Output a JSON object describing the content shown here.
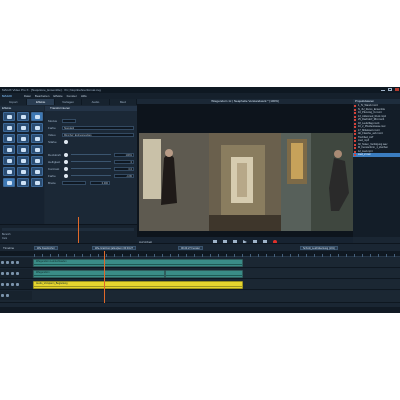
{
  "titlebar": {
    "title": "MAGIX Video Pro X · [Nuquitone_Ensemble] · X1 | Nopnbehnerformat.svg"
  },
  "menubar": {
    "logo": "MAGIX",
    "items": [
      "Datei",
      "Bearbeiten",
      "Effekte",
      "Fenster",
      "Hilfe"
    ]
  },
  "left_tabs": [
    "Import",
    "Effekte",
    "Vorlagen",
    "Audio",
    "Med"
  ],
  "effects_panel": {
    "header": "Effekte"
  },
  "properties": {
    "header": [
      "Transformieren"
    ],
    "rows": [
      {
        "label": "Modus",
        "value": ""
      },
      {
        "label": "Farbe",
        "value": "Standard"
      },
      {
        "label": "Video",
        "value": "Minichef_Endrespexdiag"
      },
      {
        "label": "Stärke",
        "value": ""
      }
    ],
    "sliders": [
      {
        "label": "Deckkraft",
        "value": "100%"
      },
      {
        "label": "Helligkeit",
        "value": "0"
      },
      {
        "label": "Kontrast",
        "value": "0.0"
      },
      {
        "label": "Farbe",
        "value": "-0.80"
      },
      {
        "label": "Breite",
        "value": "0.000"
      }
    ]
  },
  "left_timeline": {
    "rows": [
      "Bereich",
      "Cuts"
    ]
  },
  "monitor": {
    "header": "Wiegendorn 1c | Neaphelte Verstandwerk *  [100%]",
    "transport_label": "Auf Arbeit"
  },
  "browser": {
    "header": "Projektdateien",
    "items": [
      "1_IV_Wand.mxc4",
      "N_4U_Remo_Ensemble",
      "10_Pfenning_6.mxc4",
      "13_Adiusmed_Ruck.mp4",
      "25_Dachdorf_Rbt.mxc4",
      "18_Laufvillag.mxc4",
      "10_2_Pferdestrasse.mxc",
      "17_Mittelwert.mxc4",
      "Alt_Flasche_auf.mxc4",
      "Tischlied_ALT",
      "Lied_mp3",
      "02_Noten_Verfolgung.wav",
      "M_Fensterform_1_Zeichen",
      "12_Lied.mp4",
      "Lied_2.mxc"
    ],
    "selected_index": 14
  },
  "timeline": {
    "label": "Timeline",
    "tags": [
      "Wie Faudrochor",
      "Wie-Grattzoni (alles)kern 00:04:27",
      "00:24:27 Fenster",
      "Schnitt_Leichtdeckung (101)"
    ],
    "tracks": [
      {
        "clips": [
          {
            "caption": "Wiegendorn Leintuchtaufen",
            "color": "teal"
          }
        ]
      },
      {
        "clips": [
          {
            "caption": "Wiegendorn",
            "color": "teal"
          },
          {
            "caption": "",
            "color": "teal"
          }
        ]
      },
      {
        "clips": [
          {
            "caption": "Audio_Vorspann_Begleitung",
            "color": "yellow"
          }
        ]
      }
    ]
  },
  "colors": {
    "accent": "#3b7dc0",
    "playhead": "#e0692a",
    "teal_clip": "#3a8c87",
    "yellow_clip": "#e6d52e"
  }
}
